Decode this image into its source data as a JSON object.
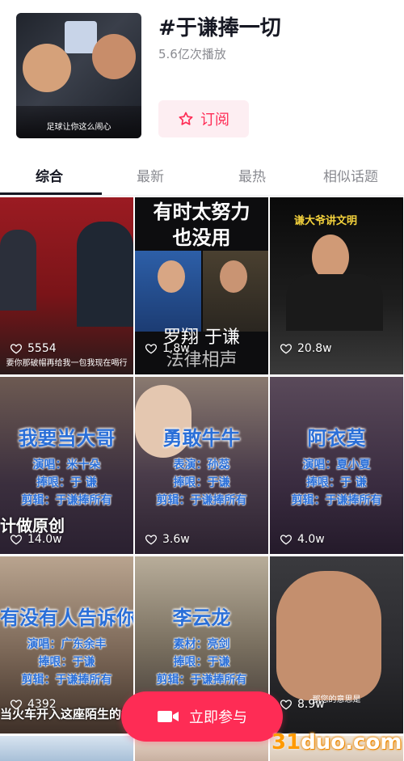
{
  "header": {
    "cover_caption": "足球让你这么闹心",
    "title": "#于谦捧一切",
    "stats": "5.6亿次播放",
    "subscribe_label": "订阅"
  },
  "tabs": [
    {
      "label": "综合",
      "active": true
    },
    {
      "label": "最新",
      "active": false
    },
    {
      "label": "最热",
      "active": false
    },
    {
      "label": "相似话题",
      "active": false
    }
  ],
  "videos": [
    {
      "likes": "5554",
      "caption": "要你那破帽再给我一包我现在喝行"
    },
    {
      "likes": "1.8w",
      "title_lines": [
        "有时太努力",
        "也没用"
      ],
      "bottom_caption": "罗翔 于谦",
      "bottom_caption2": "法律相声"
    },
    {
      "likes": "20.8w",
      "badge": "谦大爷讲文明"
    },
    {
      "likes": "14.0w",
      "title": "我要当大哥",
      "lines": [
        "演唱：米十朵",
        "捧哏：于  谦",
        "剪辑：于谦捧所有"
      ],
      "footer": "计做原创"
    },
    {
      "likes": "3.6w",
      "title": "勇敢牛牛",
      "lines": [
        "表演：孙蕊",
        "捧哏：于谦",
        "剪辑：于谦捧所有"
      ]
    },
    {
      "likes": "4.0w",
      "title": "阿衣莫",
      "lines": [
        "演唱：夏小夏",
        "捧哏：于    谦",
        "剪辑：于谦捧所有"
      ]
    },
    {
      "likes": "4392",
      "title": "有没有人告诉你",
      "lines": [
        "演唱：广东余丰",
        "捧哏：于谦",
        "剪辑：于谦捧所有"
      ],
      "footer": "当火车开入这座陌生的城"
    },
    {
      "likes": "",
      "title": "李云龙",
      "lines": [
        "素材：亮剑",
        "捧哏：于谦",
        "剪辑：于谦捧所有"
      ]
    },
    {
      "likes": "8.9w",
      "caption": "那您的意思是"
    }
  ],
  "participate_label": "立即参与",
  "watermark": {
    "digits": "31",
    "text": "duo.com"
  },
  "colors": {
    "accent": "#fe2c55",
    "overlay_blue": "#2a6fd8"
  }
}
